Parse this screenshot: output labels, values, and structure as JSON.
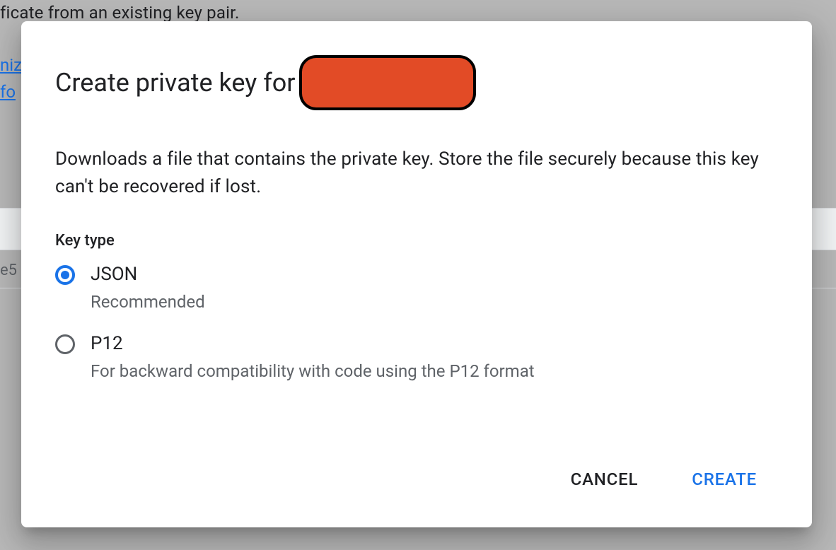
{
  "background": {
    "text_fragment": "ficate from an existing key pair.",
    "link_fragment_1": "niz",
    "link_fragment_2": " fo",
    "cell_fragment": "e5"
  },
  "modal": {
    "title_prefix": "Create private key for",
    "description": "Downloads a file that contains the private key. Store the file securely because this key can't be recovered if lost.",
    "key_type_label": "Key type",
    "options": [
      {
        "value": "json",
        "title": "JSON",
        "subtitle": "Recommended",
        "selected": true
      },
      {
        "value": "p12",
        "title": "P12",
        "subtitle": "For backward compatibility with code using the P12 format",
        "selected": false
      }
    ],
    "actions": {
      "cancel": "CANCEL",
      "create": "CREATE"
    }
  }
}
